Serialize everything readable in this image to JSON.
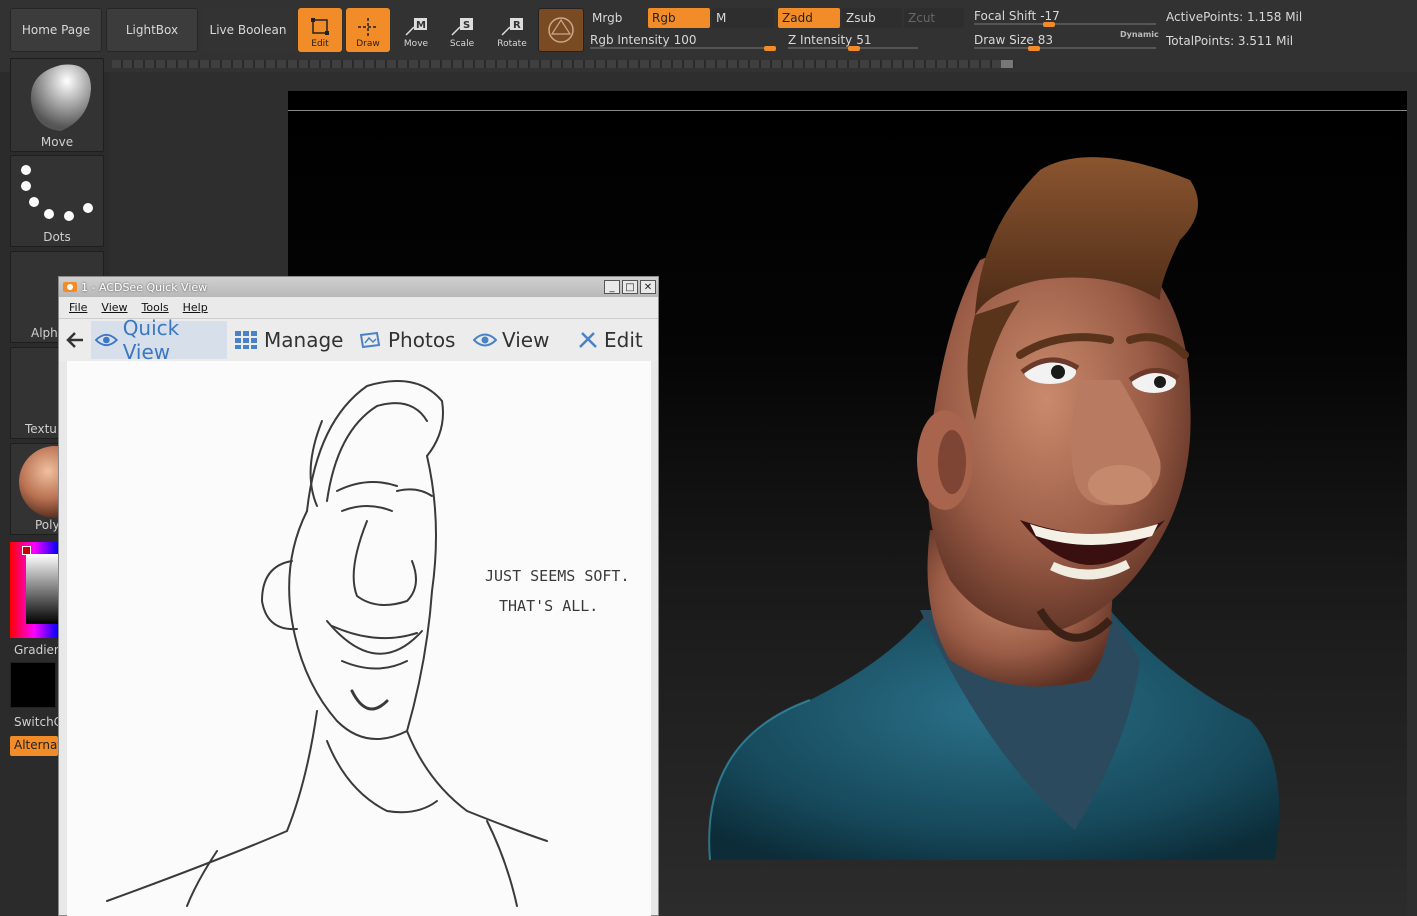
{
  "nav": {
    "home": "Home Page",
    "lightbox": "LightBox",
    "live_boolean": "Live Boolean"
  },
  "tools": {
    "edit": "Edit",
    "draw": "Draw",
    "move": "Move",
    "scale": "Scale",
    "rotate": "Rotate"
  },
  "toggles": {
    "mrgb": "Mrgb",
    "rgb": "Rgb",
    "m": "M",
    "zadd": "Zadd",
    "zsub": "Zsub",
    "zcut": "Zcut"
  },
  "sliders": {
    "rgb_intensity": {
      "label": "Rgb Intensity",
      "value": "100",
      "fraction": 1.0
    },
    "z_intensity": {
      "label": "Z Intensity",
      "value": "51",
      "fraction": 0.51
    },
    "focal_shift": {
      "label": "Focal Shift",
      "value": "-17",
      "fraction": 0.41
    },
    "draw_size": {
      "label": "Draw Size",
      "value": "83",
      "fraction": 0.33
    }
  },
  "dynamic_label": "Dynamic",
  "stats": {
    "active_points": "ActivePoints: 1.158 Mil",
    "total_points": "TotalPoints: 3.511 Mil"
  },
  "shelf": {
    "move_brush": "Move",
    "dots_stroke": "Dots",
    "alpha": "Alph",
    "texture": "Textu",
    "material": "Poly",
    "gradient": "Gradien",
    "switch_color": "SwitchC",
    "alternate": "Alternat"
  },
  "colors": {
    "accent": "#f28c28",
    "skin": "#b8735a",
    "shirt": "#1d5a6e",
    "hair": "#6b3f22"
  },
  "acdsee": {
    "title": "1 - ACDSee Quick View",
    "menu": [
      "File",
      "View",
      "Tools",
      "Help"
    ],
    "tabs": {
      "quick_view": "Quick View",
      "manage": "Manage",
      "photos": "Photos",
      "view": "View",
      "edit": "Edit"
    },
    "sketch_note_line1": "JUST SEEMS SOFT.",
    "sketch_note_line2": "THAT'S ALL."
  }
}
